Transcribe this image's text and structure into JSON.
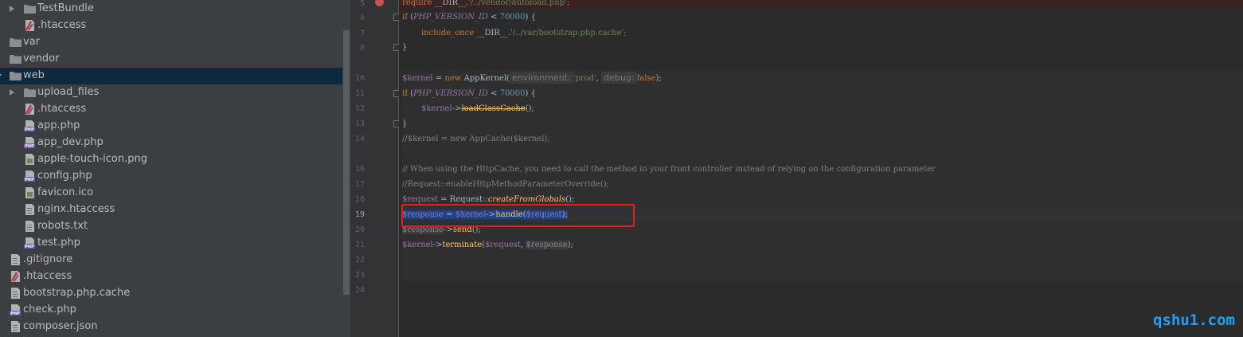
{
  "tree": {
    "items": [
      {
        "label": "TestBundle",
        "kind": "folder",
        "expand": "right"
      },
      {
        "label": ".htaccess",
        "kind": "htaccess"
      },
      {
        "label": "var",
        "kind": "folder",
        "expand": "right"
      },
      {
        "label": "vendor",
        "kind": "folder",
        "expand": "right"
      },
      {
        "label": "web",
        "kind": "folder",
        "expand": "down",
        "selected": true
      },
      {
        "label": "upload_files",
        "kind": "folder",
        "expand": "right"
      },
      {
        "label": ".htaccess",
        "kind": "htaccess"
      },
      {
        "label": "app.php",
        "kind": "php"
      },
      {
        "label": "app_dev.php",
        "kind": "php"
      },
      {
        "label": "apple-touch-icon.png",
        "kind": "image"
      },
      {
        "label": "config.php",
        "kind": "php"
      },
      {
        "label": "favicon.ico",
        "kind": "image"
      },
      {
        "label": "nginx.htaccess",
        "kind": "text"
      },
      {
        "label": "robots.txt",
        "kind": "text"
      },
      {
        "label": "test.php",
        "kind": "php"
      },
      {
        "label": ".gitignore",
        "kind": "text"
      },
      {
        "label": ".htaccess",
        "kind": "htaccess"
      },
      {
        "label": "bootstrap.php.cache",
        "kind": "text"
      },
      {
        "label": "check.php",
        "kind": "php"
      },
      {
        "label": "composer.json",
        "kind": "text"
      }
    ]
  },
  "gutter": {
    "line_numbers": [
      "5",
      "6",
      "7",
      "8",
      "10",
      "11",
      "12",
      "13",
      "14",
      "16",
      "17",
      "18",
      "19",
      "20",
      "21",
      "22",
      "23",
      "24"
    ],
    "current_line": "19"
  },
  "code": {
    "line5": {
      "kw": "require",
      "rest": " __DIR__.",
      "str": "'/../vendor/autoload.php'",
      "end": ";"
    },
    "line6": {
      "kw": "if",
      "open": " (",
      "const": "PHP_VERSION_ID",
      "op": " < ",
      "num": "70000",
      "close": ") {"
    },
    "line7": {
      "kw": "include_once",
      "rest": " __DIR__.",
      "str": "'/../var/bootstrap.php.cache'",
      "end": ";"
    },
    "line8": {
      "text": "}"
    },
    "line10": {
      "var": "$kernel",
      "eq": " = ",
      "kw": "new",
      "cls": " AppKernel(",
      "hint1": "environment:",
      "str": "'prod'",
      "comma": ", ",
      "hint2": "debug:",
      "kw2": "false",
      "end": ");"
    },
    "line11": {
      "kw": "if",
      "open": " (",
      "const": "PHP_VERSION_ID",
      "op": " < ",
      "num": "70000",
      "close": ") {"
    },
    "line12": {
      "var": "$kernel",
      "arrow": "->",
      "method": "loadClassCache",
      "end": "();"
    },
    "line13": {
      "text": "}"
    },
    "line14": {
      "comment": "//$kernel = new AppCache($kernel);"
    },
    "line16": {
      "comment": "// When using the HttpCache, you need to call the method in your front controller instead of relying on the configuration parameter"
    },
    "line17": {
      "comment": "//Request::enableHttpMethodParameterOverride();"
    },
    "line18": {
      "var": "$request",
      "eq": " = Request::",
      "method": "createFromGlobals",
      "end": "();"
    },
    "line19": {
      "var": "$response",
      "eq": " = ",
      "var2": "$kernel",
      "arrow": "->",
      "method": "handle",
      "open": "(",
      "arg": "$request",
      "end": ");"
    },
    "line20": {
      "var": "$response",
      "arrow": "->",
      "method": "send",
      "end": "();"
    },
    "line21": {
      "var": "$kernel",
      "arrow": "->",
      "method": "terminate",
      "open": "(",
      "arg": "$request",
      "comma": ", ",
      "arg2": "$response",
      "end": ");"
    }
  },
  "watermark": "qshu1.com",
  "colors": {
    "accent": "#1e9fff",
    "highlight_box": "#e02020",
    "selection": "#214283"
  }
}
